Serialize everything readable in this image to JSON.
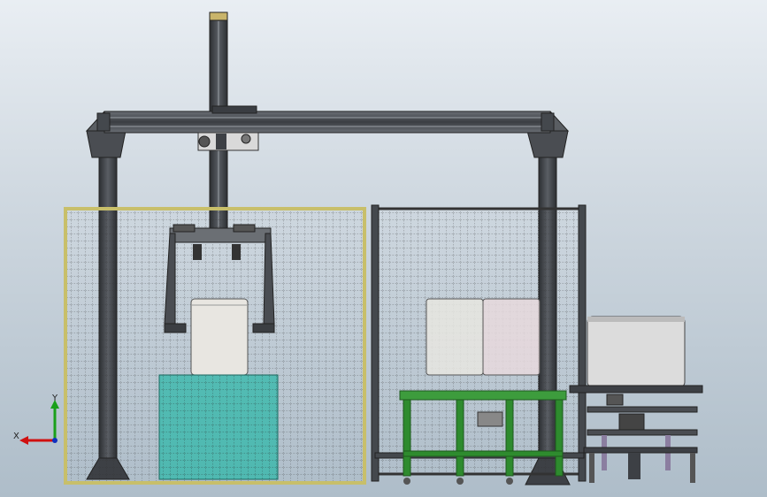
{
  "triad": {
    "y_label": "Y",
    "x_label": "X",
    "y_color": "#1aa01a",
    "x_color": "#d01010",
    "z_color": "#1030c0"
  },
  "colors": {
    "frame_dark": "#3c3f44",
    "frame_mid": "#55595f",
    "fence_left_border": "#c8bf6a",
    "fence_mesh": "#2d2d2d",
    "teal_block": "#2fb7a8",
    "green_table": "#2e8b2e",
    "box_white": "#e8e6e1"
  }
}
